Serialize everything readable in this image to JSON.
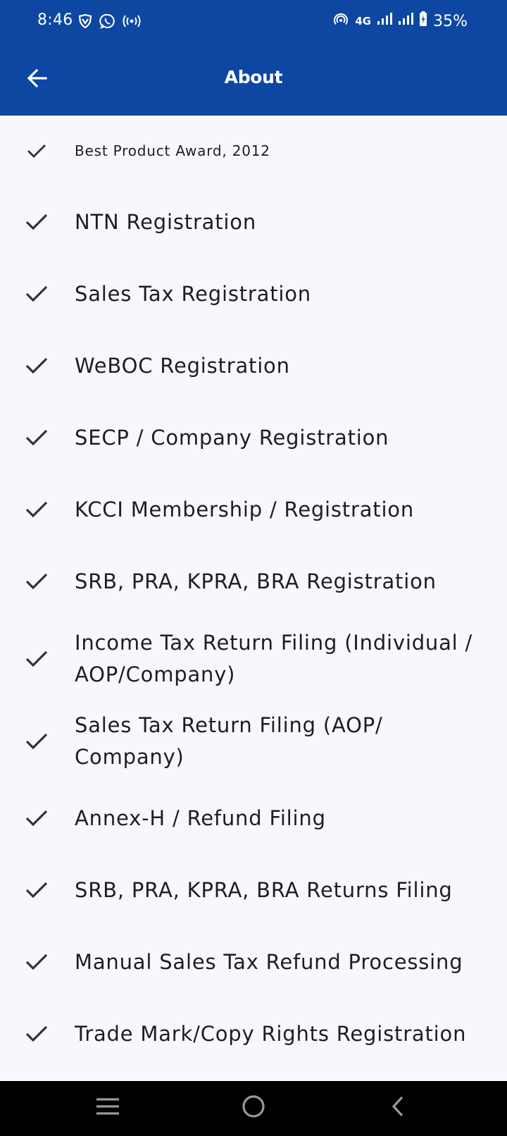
{
  "status_bar": {
    "time": "8:46",
    "network": "4G",
    "battery": "35%",
    "icons": [
      "vpn-shield-icon",
      "whatsapp-icon",
      "broadcast-icon",
      "hotspot-icon",
      "signal-icon",
      "signal-icon",
      "battery-charging-icon"
    ]
  },
  "app_bar": {
    "title": "About",
    "back_icon": "arrow-back-icon",
    "background": "#0D47A1"
  },
  "items": [
    {
      "label": "Best Product Award, 2012",
      "icon": "check-icon"
    },
    {
      "label": "NTN Registration",
      "icon": "check-icon"
    },
    {
      "label": "Sales Tax Registration",
      "icon": "check-icon"
    },
    {
      "label": "WeBOC Registration",
      "icon": "check-icon"
    },
    {
      "label": "SECP / Company Registration",
      "icon": "check-icon"
    },
    {
      "label": "KCCI Membership / Registration",
      "icon": "check-icon"
    },
    {
      "label": "SRB, PRA, KPRA, BRA Registration",
      "icon": "check-icon"
    },
    {
      "label": "Income Tax Return Filing (Individual / AOP/Company)",
      "icon": "check-icon"
    },
    {
      "label": "Sales Tax Return Filing (AOP/ Company)",
      "icon": "check-icon"
    },
    {
      "label": "Annex-H / Refund Filing",
      "icon": "check-icon"
    },
    {
      "label": "SRB, PRA, KPRA, BRA Returns Filing",
      "icon": "check-icon"
    },
    {
      "label": "Manual Sales Tax Refund Processing",
      "icon": "check-icon"
    },
    {
      "label": "Trade Mark/Copy Rights Registration",
      "icon": "check-icon"
    }
  ],
  "nav_bar": {
    "buttons": [
      "recent-apps-icon",
      "home-icon",
      "back-icon"
    ]
  }
}
